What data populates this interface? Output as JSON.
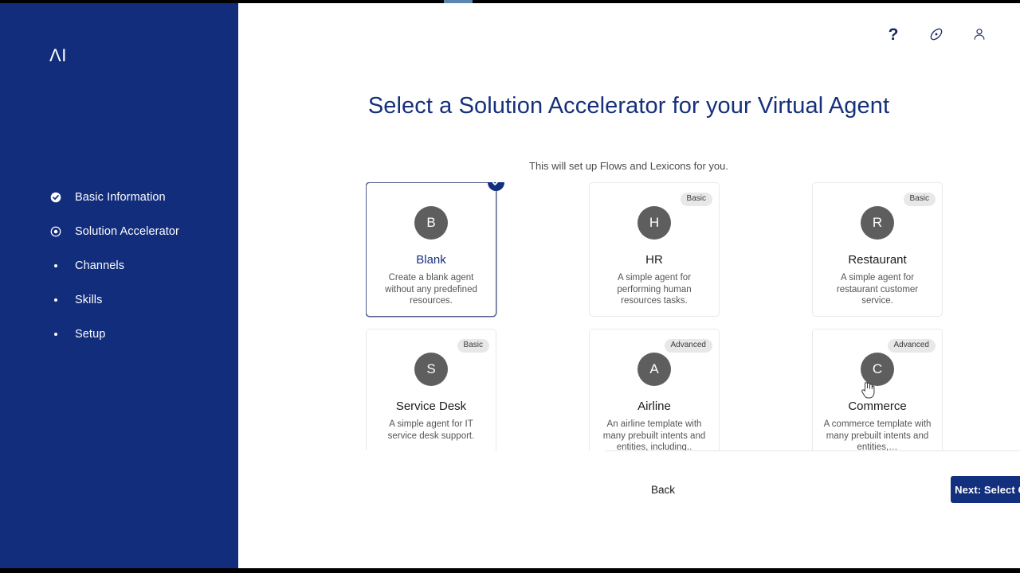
{
  "window": {
    "loading_bar_visible": true,
    "brand_color": "#13307e",
    "sidebar_color": "#122d7b"
  },
  "sidebar": {
    "logo_text": "ΛI",
    "items": [
      {
        "label": "Basic Information",
        "icon": "check-circle-icon",
        "state": "completed"
      },
      {
        "label": "Solution Accelerator",
        "icon": "radio-selected-icon",
        "state": "current"
      },
      {
        "label": "Channels",
        "icon": "dot-icon",
        "state": "pending"
      },
      {
        "label": "Skills",
        "icon": "dot-icon",
        "state": "pending"
      },
      {
        "label": "Setup",
        "icon": "dot-icon",
        "state": "pending"
      }
    ]
  },
  "header": {
    "icons": [
      {
        "name": "help-icon",
        "glyph": "?"
      },
      {
        "name": "explore-compass-icon",
        "glyph": "compass"
      },
      {
        "name": "user-account-icon",
        "glyph": "person"
      }
    ]
  },
  "main": {
    "title": "Select a Solution Accelerator for your Virtual Agent",
    "subtitle": "This will set up Flows and Lexicons for you.",
    "cards": [
      {
        "initial": "B",
        "title": "Blank",
        "description": "Create a blank agent without any predefined resources.",
        "badge": "",
        "selected": true
      },
      {
        "initial": "H",
        "title": "HR",
        "description": "A simple agent for performing human resources tasks.",
        "badge": "Basic",
        "selected": false
      },
      {
        "initial": "R",
        "title": "Restaurant",
        "description": "A simple agent for restaurant customer service.",
        "badge": "Basic",
        "selected": false
      },
      {
        "initial": "S",
        "title": "Service Desk",
        "description": "A simple agent for IT service desk support.",
        "badge": "Basic",
        "selected": false
      },
      {
        "initial": "A",
        "title": "Airline",
        "description": "An airline template with many prebuilt intents and entities, including..",
        "badge": "Advanced",
        "selected": false
      },
      {
        "initial": "C",
        "title": "Commerce",
        "description": "A commerce template with many prebuilt intents and entities,…",
        "badge": "Advanced",
        "selected": false
      }
    ]
  },
  "footer": {
    "back_label": "Back",
    "next_label": "Next: Select Channels"
  }
}
